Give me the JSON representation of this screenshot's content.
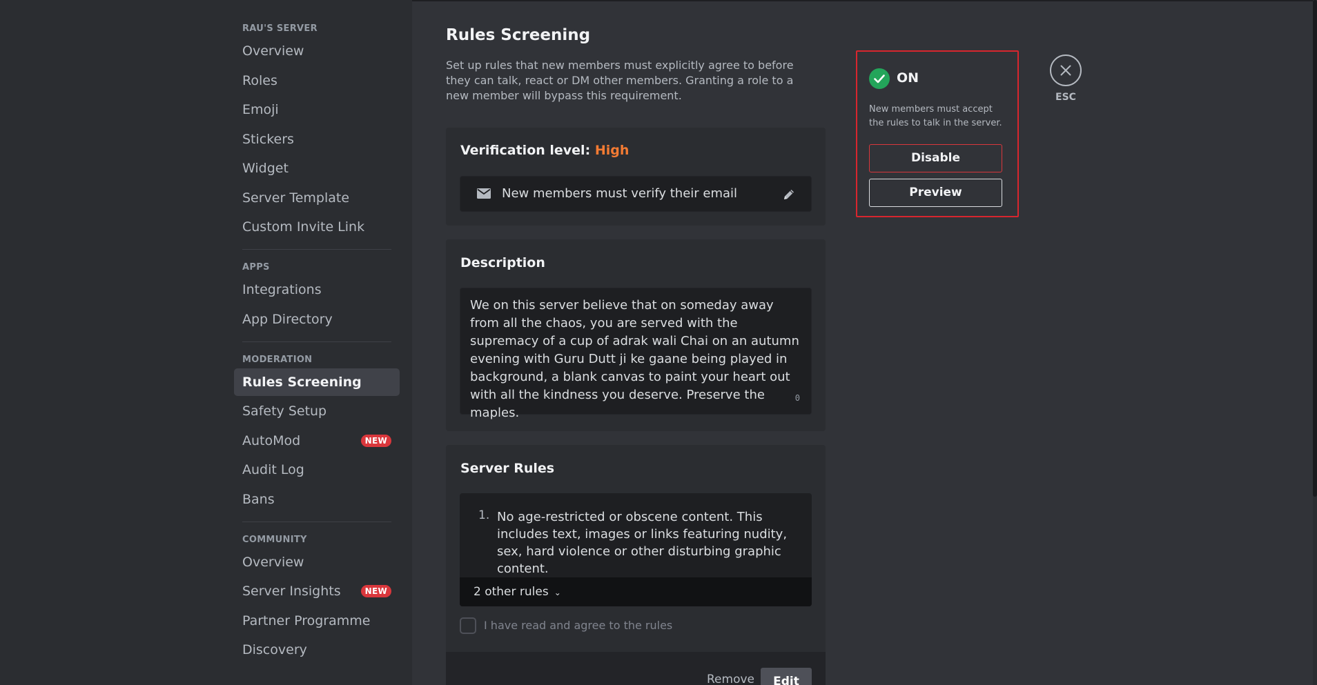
{
  "sidebar": {
    "server_header": "RAU'S SERVER",
    "server_items": [
      {
        "label": "Overview"
      },
      {
        "label": "Roles"
      },
      {
        "label": "Emoji"
      },
      {
        "label": "Stickers"
      },
      {
        "label": "Widget"
      },
      {
        "label": "Server Template"
      },
      {
        "label": "Custom Invite Link"
      }
    ],
    "apps_header": "APPS",
    "apps_items": [
      {
        "label": "Integrations"
      },
      {
        "label": "App Directory"
      }
    ],
    "moderation_header": "MODERATION",
    "moderation_items": [
      {
        "label": "Rules Screening"
      },
      {
        "label": "Safety Setup"
      },
      {
        "label": "AutoMod",
        "badge": "NEW"
      },
      {
        "label": "Audit Log"
      },
      {
        "label": "Bans"
      }
    ],
    "community_header": "COMMUNITY",
    "community_items": [
      {
        "label": "Overview"
      },
      {
        "label": "Server Insights",
        "badge": "NEW"
      },
      {
        "label": "Partner Programme"
      },
      {
        "label": "Discovery"
      }
    ]
  },
  "main": {
    "title": "Rules Screening",
    "description": "Set up rules that new members must explicitly agree to before they can talk, react or DM other members. Granting a role to a new member will bypass this requirement.",
    "verification": {
      "label": "Verification level:",
      "level": "High",
      "requirement": "New members must verify their email"
    },
    "description_card": {
      "title": "Description",
      "text": "We on this server believe that on someday away from all the chaos, you are served with the supremacy of a cup of adrak wali Chai on an autumn evening with Guru Dutt ji ke gaane  being played in background, a blank canvas to paint your heart out with all the kindness you deserve. Preserve the maples.",
      "char_count": "0"
    },
    "rules_card": {
      "title": "Server Rules",
      "rules": [
        {
          "number": "1.",
          "text": "No age-restricted or obscene content. This includes text, images or links featuring nudity, sex, hard violence or other disturbing graphic content."
        }
      ],
      "other_rules": "2 other rules",
      "agree_label": "I have read and agree to the rules",
      "remove_label": "Remove",
      "edit_label": "Edit"
    }
  },
  "status_panel": {
    "state": "ON",
    "note": "New members must accept the rules to talk in the server.",
    "disable_label": "Disable",
    "preview_label": "Preview"
  },
  "close": {
    "label": "ESC"
  },
  "colors": {
    "accent_green": "#23a55a",
    "danger_red": "#da373c",
    "verification_orange": "#f47b33",
    "highlight_frame": "#d9262e"
  }
}
